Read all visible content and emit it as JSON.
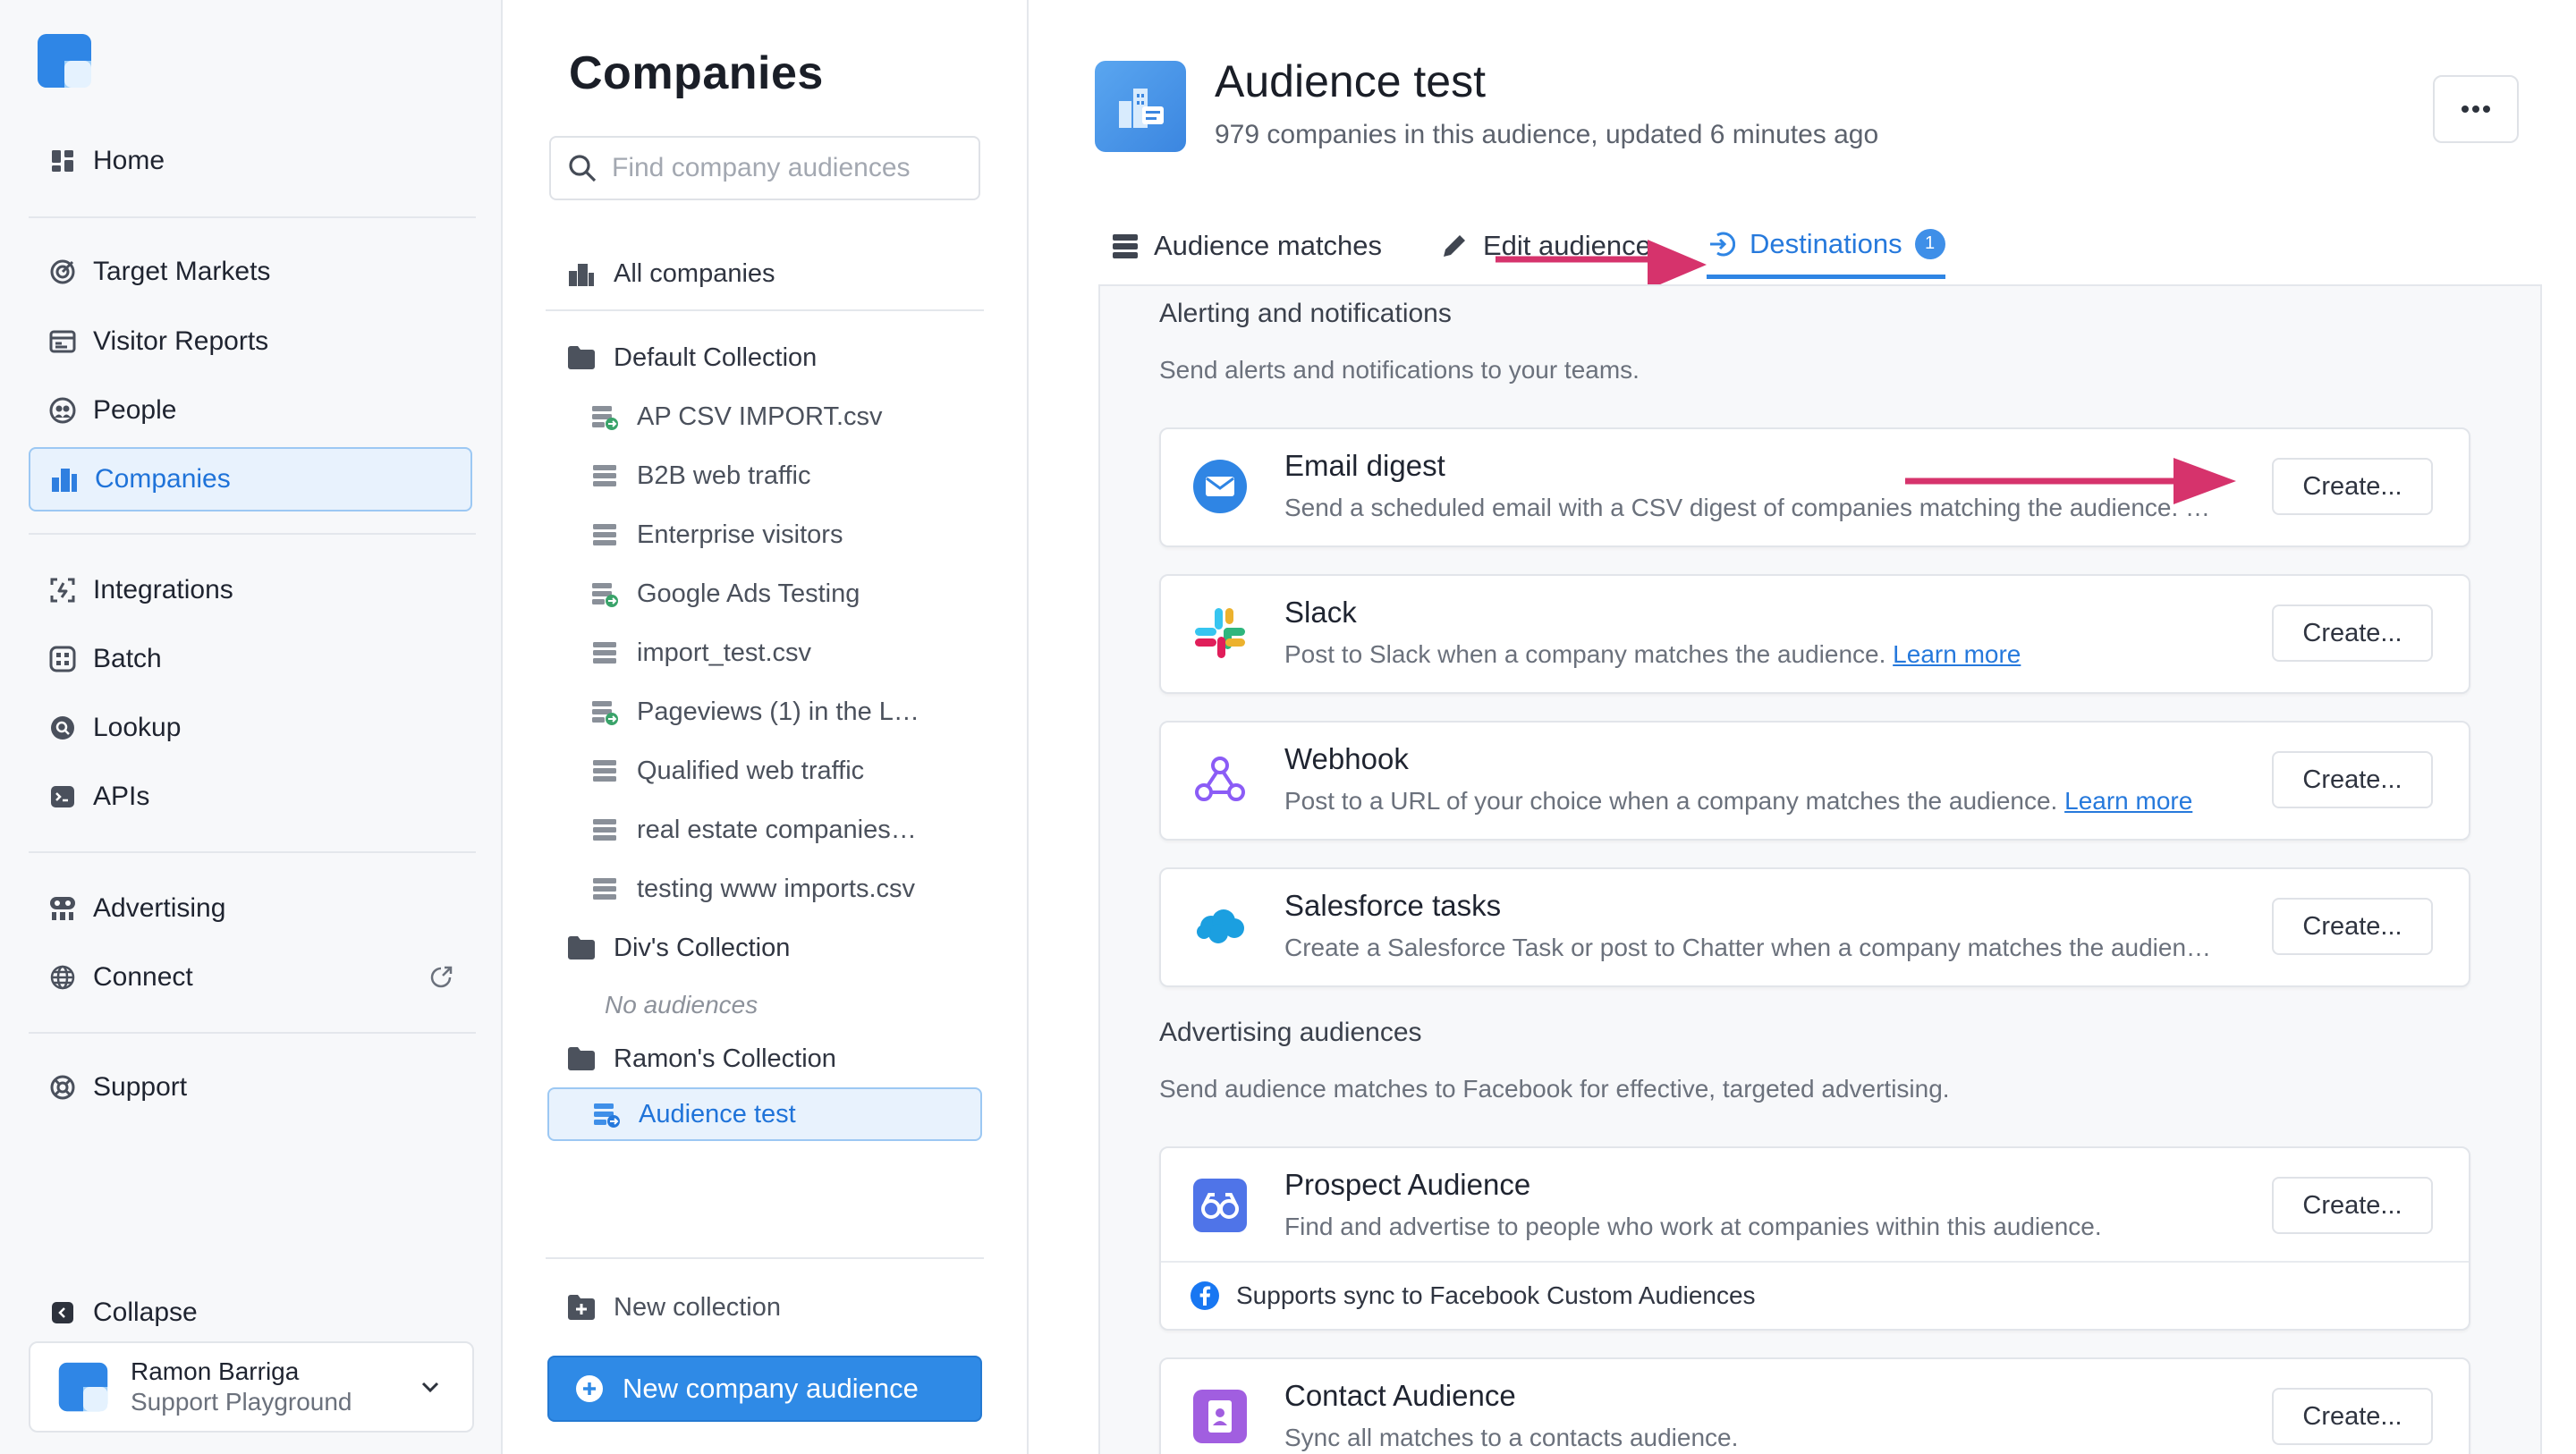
{
  "nav": {
    "items": [
      {
        "label": "Home",
        "icon": "home-icon"
      },
      {
        "label": "Target Markets",
        "icon": "target-icon"
      },
      {
        "label": "Visitor Reports",
        "icon": "report-icon"
      },
      {
        "label": "People",
        "icon": "people-icon"
      },
      {
        "label": "Companies",
        "icon": "building-icon",
        "active": true
      },
      {
        "label": "Integrations",
        "icon": "integrations-icon"
      },
      {
        "label": "Batch",
        "icon": "batch-icon"
      },
      {
        "label": "Lookup",
        "icon": "lookup-icon"
      },
      {
        "label": "APIs",
        "icon": "terminal-icon"
      },
      {
        "label": "Advertising",
        "icon": "advertising-icon"
      },
      {
        "label": "Connect",
        "icon": "globe-icon"
      },
      {
        "label": "Support",
        "icon": "support-icon"
      },
      {
        "label": "Collapse",
        "icon": "collapse-icon"
      }
    ],
    "user": {
      "name": "Ramon Barriga",
      "org": "Support Playground"
    }
  },
  "middle": {
    "title": "Companies",
    "search_placeholder": "Find company audiences",
    "all_companies": "All companies",
    "collections": [
      {
        "name": "Default Collection",
        "audiences": [
          "AP CSV IMPORT.csv",
          "B2B web traffic",
          "Enterprise visitors",
          "Google Ads Testing",
          "import_test.csv",
          "Pageviews (1) in the L…",
          "Qualified web traffic",
          "real estate companies…",
          "testing www imports.csv"
        ]
      },
      {
        "name": "Div's Collection",
        "empty_label": "No audiences"
      },
      {
        "name": "Ramon's Collection",
        "audiences": [
          "Audience test"
        ]
      }
    ],
    "new_collection": "New collection",
    "new_audience_button": "New company audience"
  },
  "main": {
    "title": "Audience test",
    "subtitle": "979 companies in this audience, updated 6 minutes ago",
    "tabs": [
      {
        "label": "Audience matches"
      },
      {
        "label": "Edit audience"
      },
      {
        "label": "Destinations",
        "badge": "1",
        "active": true
      }
    ],
    "sections": [
      {
        "title": "Alerting and notifications",
        "description": "Send alerts and notifications to your teams.",
        "cards": [
          {
            "title": "Email digest",
            "description": "Send a scheduled email with a CSV digest of companies matching the audience. …",
            "button": "Create...",
            "icon": "email-icon"
          },
          {
            "title": "Slack",
            "description": "Post to Slack when a company matches the audience.",
            "link": "Learn more",
            "button": "Create...",
            "icon": "slack-icon"
          },
          {
            "title": "Webhook",
            "description": "Post to a URL of your choice when a company matches the audience.",
            "link": "Learn more",
            "button": "Create...",
            "icon": "webhook-icon"
          },
          {
            "title": "Salesforce tasks",
            "description": "Create a Salesforce Task or post to Chatter when a company matches the audien…",
            "button": "Create...",
            "icon": "salesforce-icon"
          }
        ]
      },
      {
        "title": "Advertising audiences",
        "description": "Send audience matches to Facebook for effective, targeted advertising.",
        "cards": [
          {
            "title": "Prospect Audience",
            "description": "Find and advertise to people who work at companies within this audience.",
            "button": "Create...",
            "footer": "Supports sync to Facebook Custom Audiences",
            "icon": "binoculars-icon"
          },
          {
            "title": "Contact Audience",
            "description": "Sync all matches to a contacts audience.",
            "button": "Create...",
            "icon": "contact-icon"
          }
        ]
      }
    ]
  },
  "colors": {
    "accent": "#2f85e4",
    "annotation_arrow": "#d6336c"
  }
}
